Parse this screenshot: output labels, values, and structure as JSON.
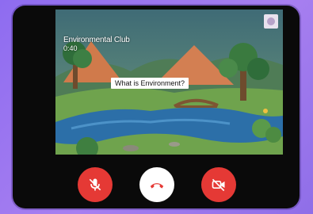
{
  "call": {
    "title": "Environmental Club",
    "timer": "0:40",
    "caption": "What is Environment?"
  },
  "controls": {
    "mic": {
      "icon": "mic-off-icon"
    },
    "end": {
      "icon": "end-call-icon"
    },
    "camera": {
      "icon": "videocam-off-icon"
    }
  },
  "colors": {
    "background": "#9b77ee",
    "control_red": "#e53935",
    "end_call_bg": "#ffffff",
    "end_call_icon": "#e53935"
  }
}
